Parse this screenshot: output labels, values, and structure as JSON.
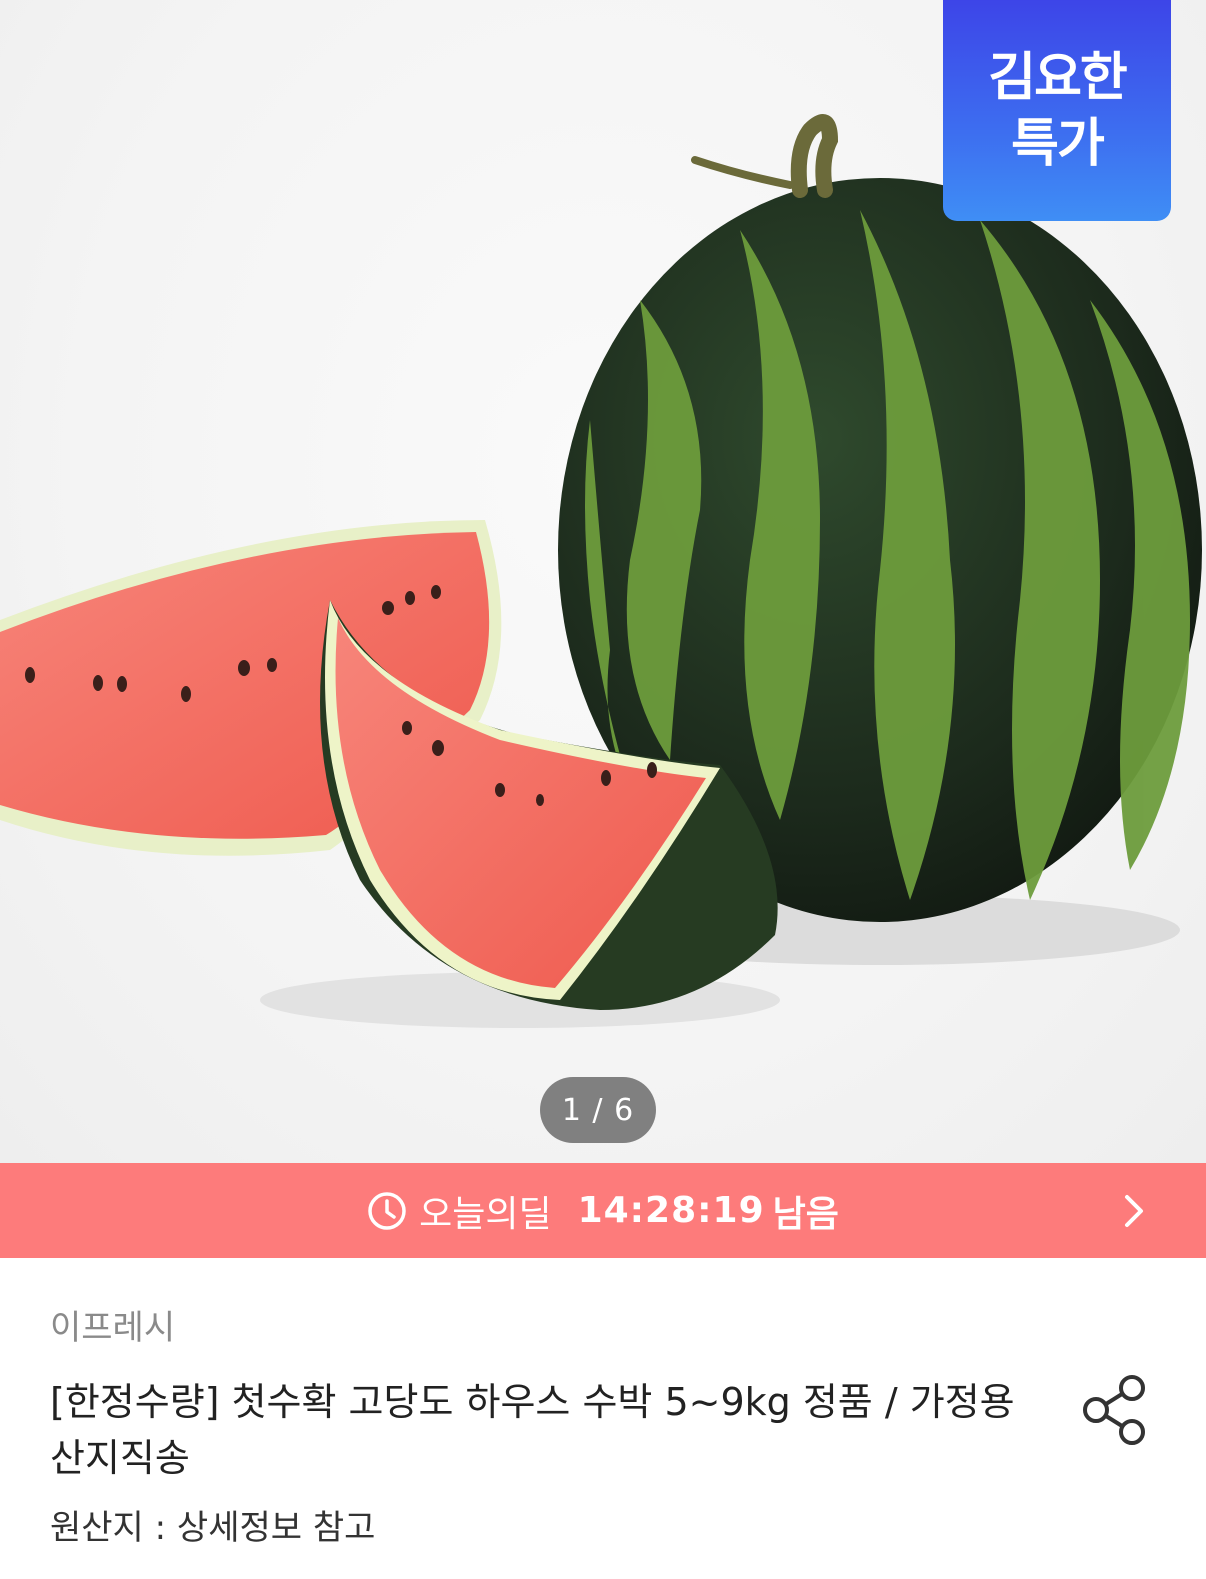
{
  "badge": {
    "line1": "김요한",
    "line2": "특가"
  },
  "gallery": {
    "counter": "1 / 6"
  },
  "deal": {
    "label": "오늘의딜",
    "time": "14:28:19",
    "remaining": "남음"
  },
  "product": {
    "seller": "이프레시",
    "title": "[한정수량] 첫수확 고당도 하우스 수박 5~9kg 정품 / 가정용 산지직송",
    "origin": "원산지 : 상세정보 참고"
  },
  "icons": {
    "clock": "clock-icon",
    "arrow": "chevron-right-icon",
    "share": "share-icon"
  },
  "colors": {
    "deal_bar": "#fd7b7b",
    "badge": "#3d6ef0"
  }
}
